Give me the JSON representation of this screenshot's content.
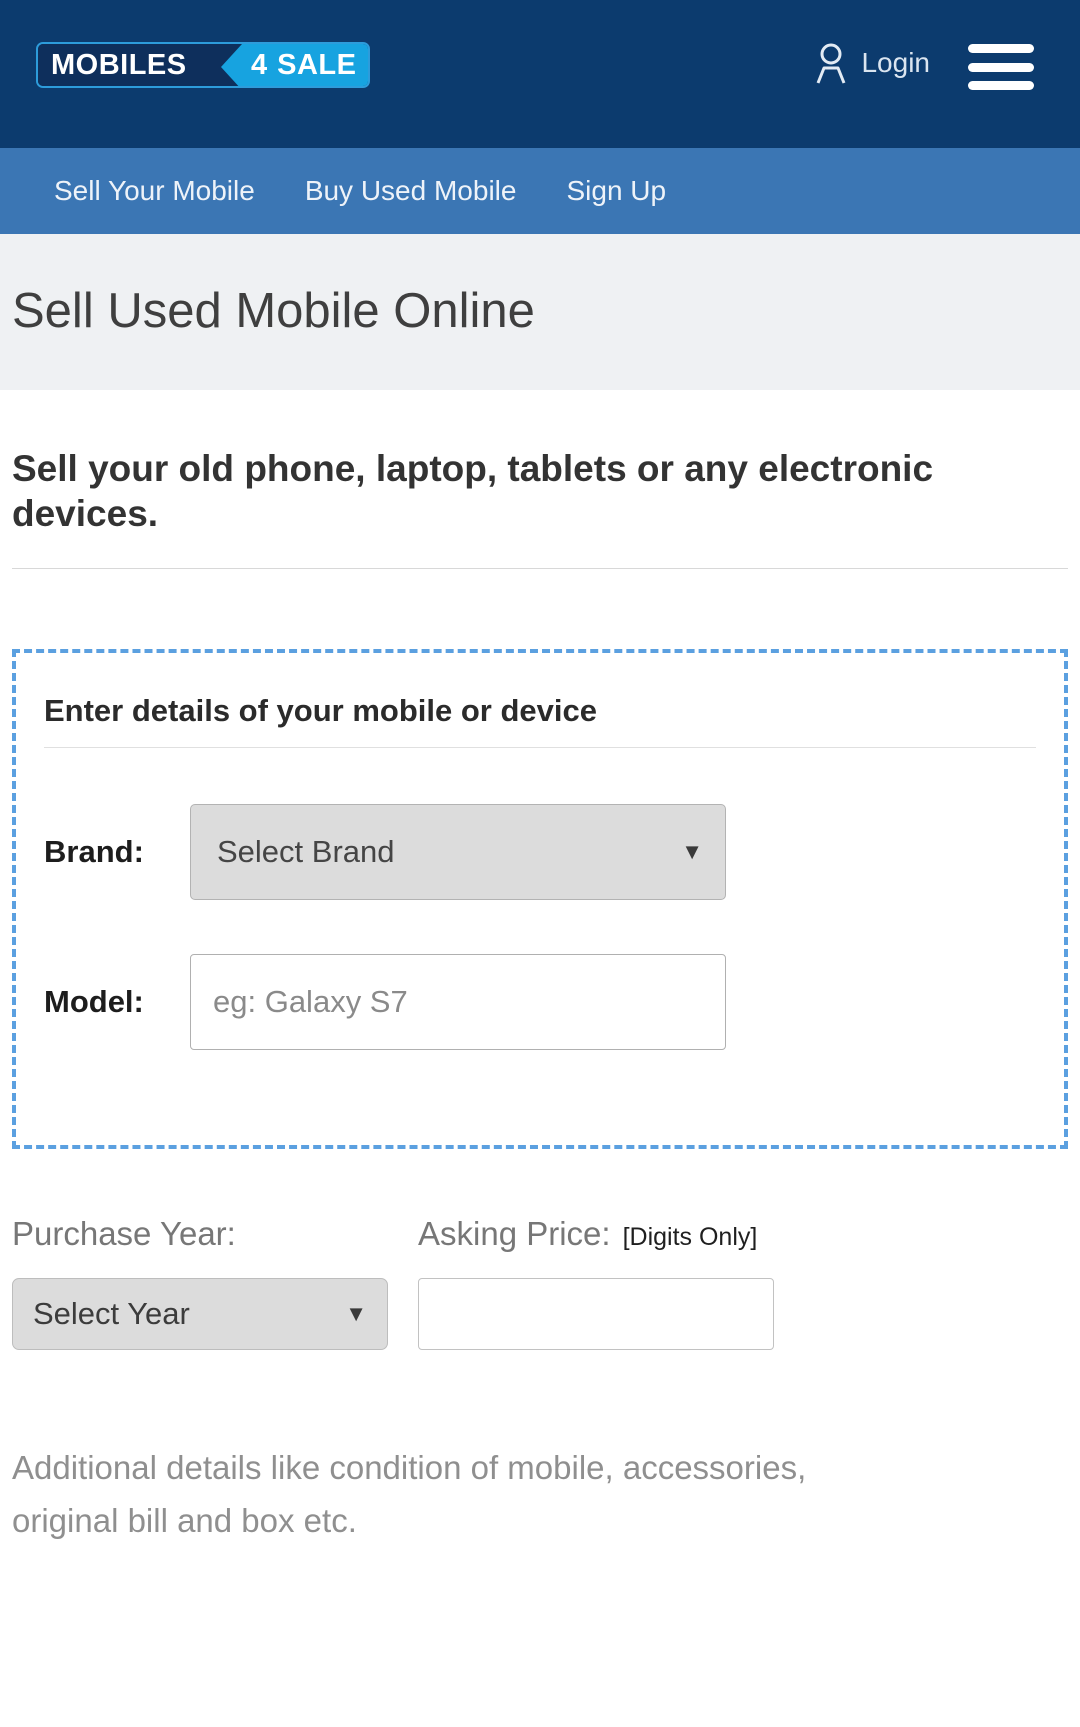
{
  "header": {
    "logo": {
      "primary_text": "MOBILES",
      "accent_text": "4",
      "secondary_text": "SALE",
      "dark_color": "#0e2f5c",
      "accent_color": "#17a3e0"
    },
    "login_label": "Login",
    "bar_color": "#0c3b6e"
  },
  "nav": {
    "bar_color": "#3b76b4",
    "items": [
      {
        "label": "Sell Your Mobile"
      },
      {
        "label": "Buy Used Mobile"
      },
      {
        "label": "Sign Up"
      }
    ]
  },
  "page": {
    "title": "Sell Used Mobile Online",
    "title_band_color": "#eff1f3",
    "subtitle": "Sell your old phone, laptop, tablets or any electronic devices."
  },
  "details_box": {
    "border_color": "#5ba0e0",
    "heading": "Enter details of your mobile or device",
    "brand": {
      "label": "Brand:",
      "selected": "Select Brand",
      "arrow": "chevron-down-icon"
    },
    "model": {
      "label": "Model:",
      "value": "",
      "placeholder": "eg: Galaxy S7"
    }
  },
  "secondary": {
    "purchase_year": {
      "label": "Purchase Year:",
      "selected": "Select Year",
      "arrow": "chevron-down-icon"
    },
    "asking_price": {
      "label": "Asking Price:",
      "note": "[Digits Only]",
      "value": "",
      "placeholder": ""
    }
  },
  "footer_note": "Additional details like condition of mobile, accessories, original bill and box etc."
}
